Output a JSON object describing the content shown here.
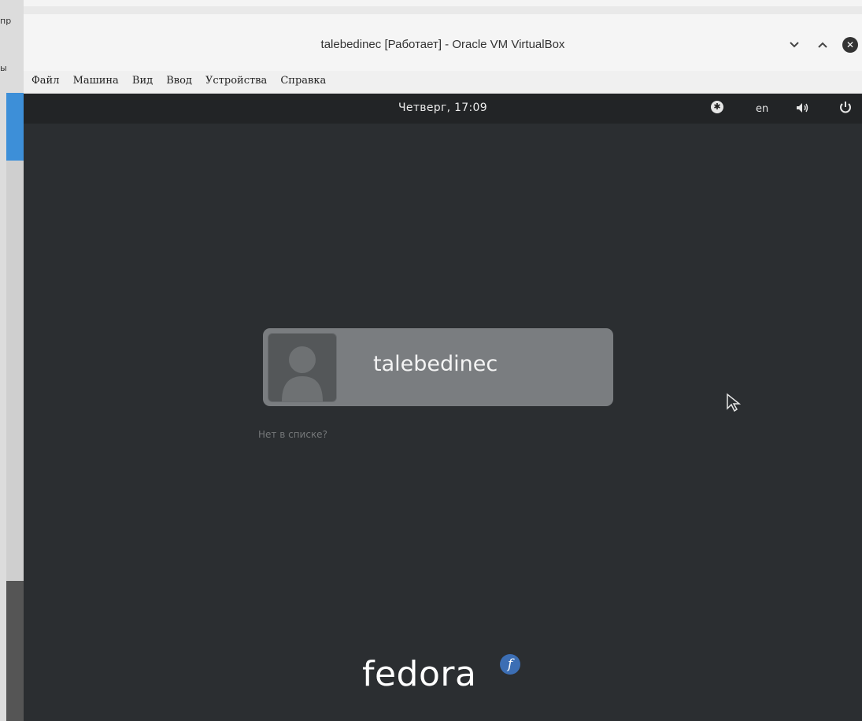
{
  "window": {
    "title": "talebedinec [Работает] - Oracle VM VirtualBox",
    "controls": {
      "minimize": "⌄",
      "maximize": "^",
      "close": "✕"
    }
  },
  "menubar": {
    "items": [
      {
        "label": "Файл"
      },
      {
        "label": "Машина"
      },
      {
        "label": "Вид"
      },
      {
        "label": "Ввод"
      },
      {
        "label": "Устройства"
      },
      {
        "label": "Справка"
      }
    ]
  },
  "guest": {
    "topbar": {
      "clock": "Четверг, 17:09",
      "language": "en",
      "icons": [
        "accessibility-icon",
        "volume-icon",
        "power-icon"
      ]
    },
    "login": {
      "username": "talebedinec",
      "not_listed": "Нет в списке?"
    },
    "logo": {
      "text": "fedora",
      "badge": "f"
    }
  },
  "host": {
    "fragments": [
      "пр",
      "ы"
    ]
  },
  "colors": {
    "guest_background": "#2b2e31",
    "topbar": "#222426",
    "user_card": "#7a7d80",
    "fedora_blue": "#3c6eb4"
  }
}
